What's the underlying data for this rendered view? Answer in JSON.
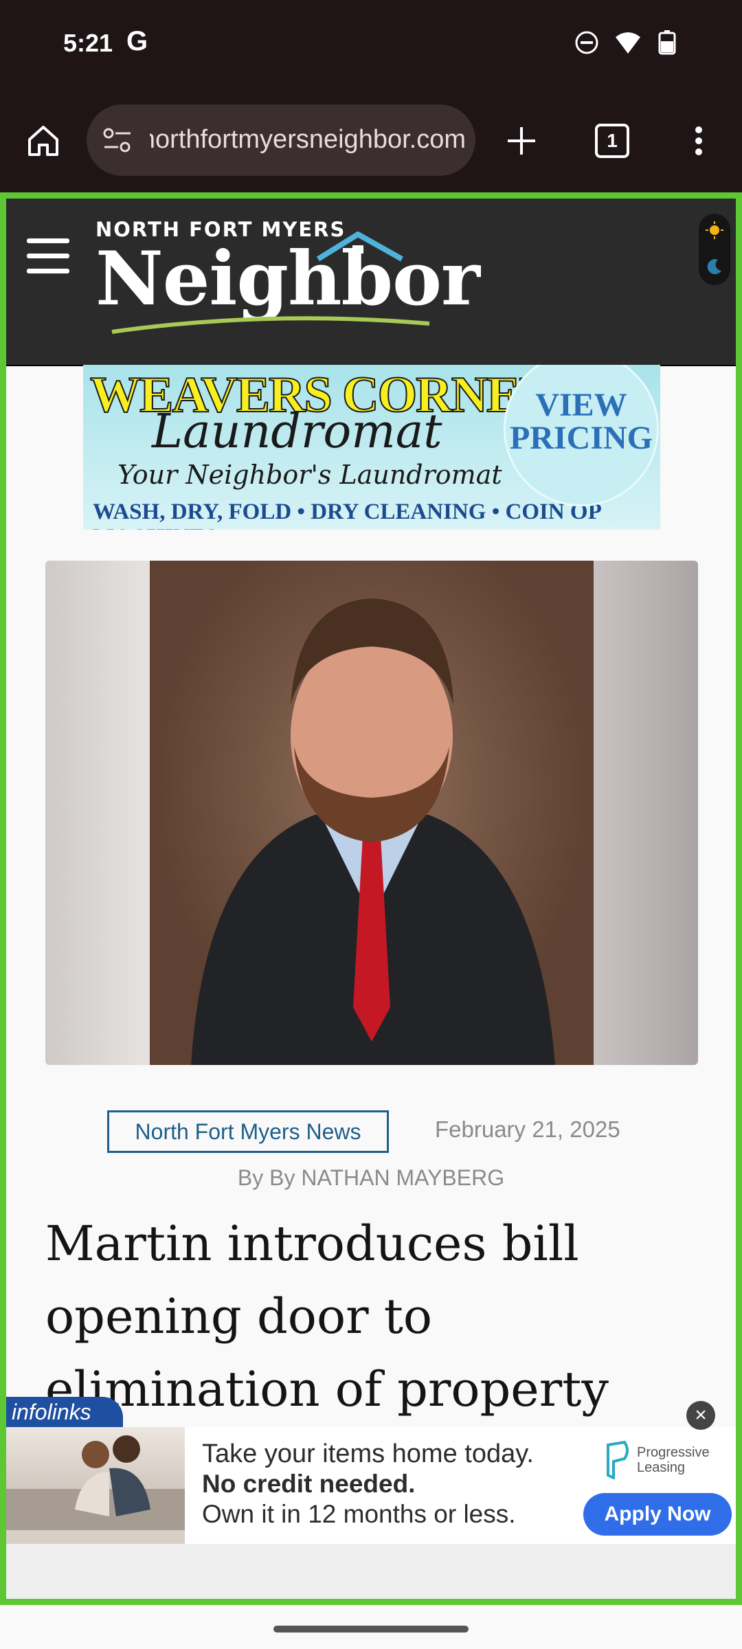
{
  "status_bar": {
    "time": "5:21",
    "g_logo": "G",
    "icons": [
      "do-not-disturb-icon",
      "wifi-icon",
      "battery-icon"
    ]
  },
  "browser": {
    "url": "northfortmyersneighbor.com",
    "tab_count": "1"
  },
  "site": {
    "logo_top": "NORTH FORT MYERS",
    "logo_main": "Neighbor"
  },
  "ad_banner": {
    "line1": "WEAVERS CORNER",
    "line2": "Laundromat",
    "line3": "Your Neighbor's Laundromat",
    "line4": "WASH, DRY, FOLD • DRY CLEANING • COIN OP MACHINES",
    "cta_line1": "VIEW",
    "cta_line2": "PRICING"
  },
  "article": {
    "category": "North Fort Myers News",
    "date": "February 21, 2025",
    "byline": "By By NATHAN MAYBERG",
    "headline": "Martin introduces bill opening door to elimination of property taxes though"
  },
  "bottom_ad": {
    "brand_tag": "infolinks",
    "line1": "Take your items home today.",
    "line2": "No credit needed.",
    "line3": "Own it in 12 months or less.",
    "logo_line1": "Progressive",
    "logo_line2": "Leasing",
    "button": "Apply Now",
    "close": "×"
  },
  "colors": {
    "frame": "#5dc734",
    "accent": "#1d5f8a",
    "apply_button": "#2f6ee8"
  }
}
